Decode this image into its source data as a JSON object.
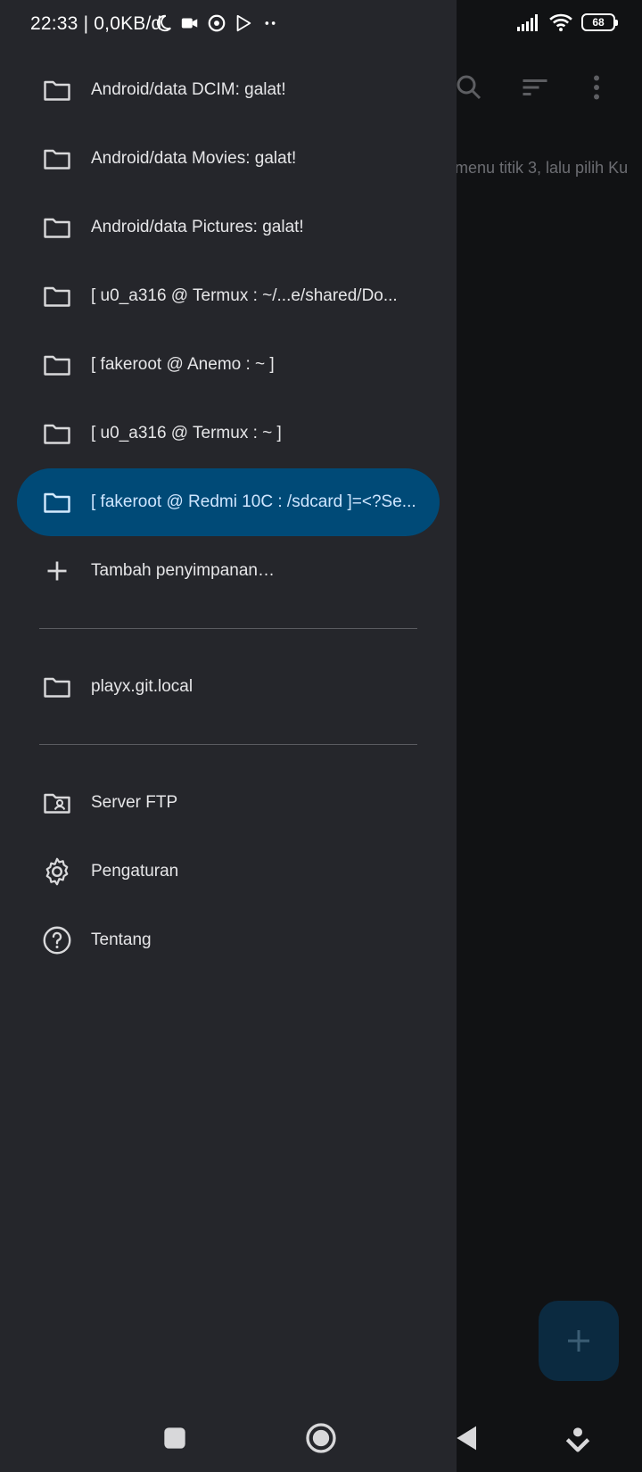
{
  "status_bar": {
    "time_text": "22:33 | 0,0KB/d",
    "battery": "68"
  },
  "background": {
    "hint_text": "menu titik 3, lalu pilih Ku"
  },
  "drawer": {
    "storage_items": [
      {
        "label": "Android/data DCIM: galat!",
        "icon": "folder-icon"
      },
      {
        "label": "Android/data Movies: galat!",
        "icon": "folder-icon"
      },
      {
        "label": "Android/data Pictures: galat!",
        "icon": "folder-icon"
      },
      {
        "label": "[ u0_a316 @ Termux : ~/...e/shared/Do...",
        "icon": "folder-icon"
      },
      {
        "label": "[ fakeroot @ Anemo : ~ ]",
        "icon": "folder-icon"
      },
      {
        "label": "[ u0_a316 @ Termux : ~ ]",
        "icon": "folder-icon"
      },
      {
        "label": "[ fakeroot @ Redmi 10C : /sdcard ]=<?Se...",
        "icon": "folder-icon",
        "selected": true
      }
    ],
    "add_storage_label": "Tambah penyimpanan…",
    "bookmark_items": [
      {
        "label": "playx.git.local",
        "icon": "folder-icon"
      }
    ],
    "menu_items": [
      {
        "label": "Server FTP",
        "icon": "folder-shared-icon"
      },
      {
        "label": "Pengaturan",
        "icon": "gear-icon"
      },
      {
        "label": "Tentang",
        "icon": "help-circle-icon"
      }
    ]
  },
  "colors": {
    "drawer_bg": "#25262b",
    "selected_pill": "#004a77",
    "background_app": "#111214"
  }
}
